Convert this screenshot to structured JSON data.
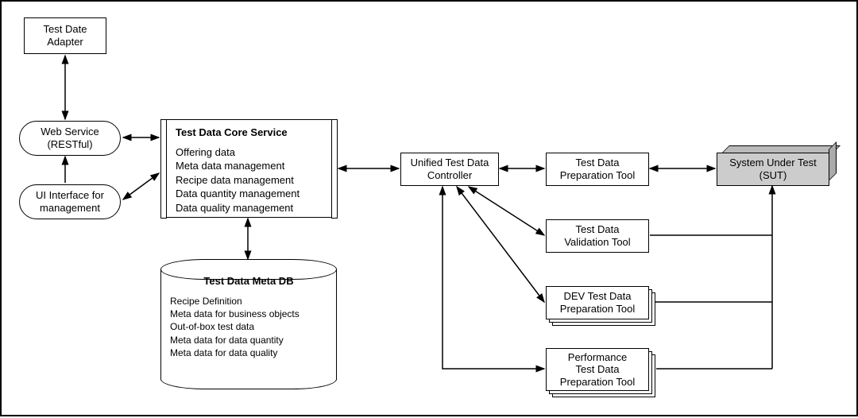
{
  "adapter": "Test Date\nAdapter",
  "webService": "Web Service\n(RESTful)",
  "uiInterface": "UI Interface for\nmanagement",
  "core": {
    "title": "Test Data Core Service",
    "items": [
      "Offering data",
      "Meta data management",
      "Recipe data management",
      "Data quantity management",
      "Data quality management"
    ]
  },
  "db": {
    "title": "Test Data Meta DB",
    "items": [
      "Recipe Definition",
      "Meta data for business objects",
      "Out-of-box test data",
      "Meta data for data quantity",
      "Meta data for data quality"
    ]
  },
  "controller": "Unified Test Data\nController",
  "tools": {
    "prep": "Test Data\nPreparation Tool",
    "valid": "Test Data\nValidation Tool",
    "dev": "DEV Test Data\nPreparation Tool",
    "perf": "Performance\nTest Data\nPreparation Tool"
  },
  "sut": "System Under Test\n(SUT)"
}
